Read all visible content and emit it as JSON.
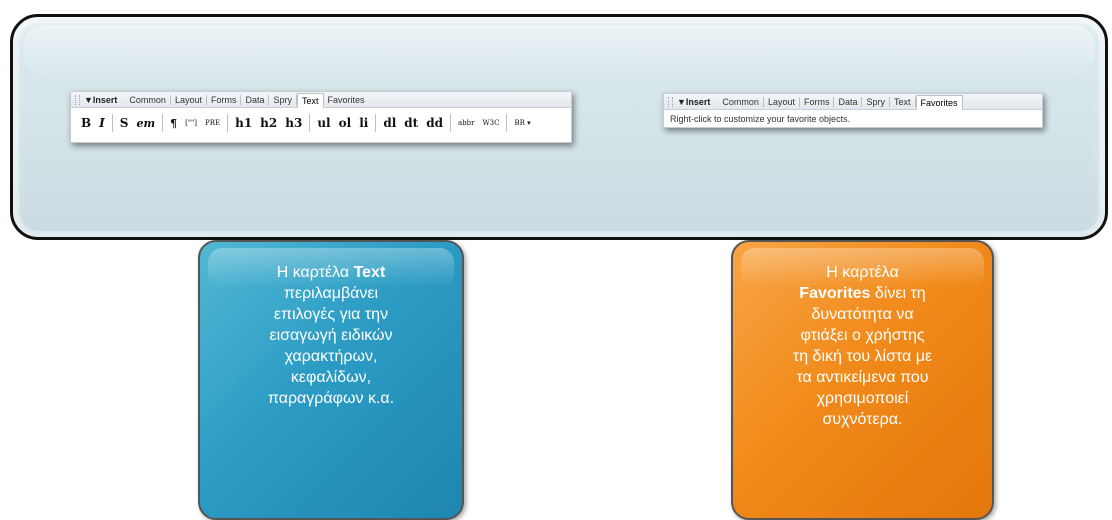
{
  "left_toolbar": {
    "insert_label": "▼Insert",
    "tabs": [
      "Common",
      "Layout",
      "Forms",
      "Data",
      "Spry",
      "Text",
      "Favorites"
    ],
    "active_tab": "Text",
    "buttons": [
      "B",
      "I",
      "S",
      "em",
      "¶",
      "[\"\"]",
      "PRE",
      "h1",
      "h2",
      "h3",
      "ul",
      "ol",
      "li",
      "dl",
      "dt",
      "dd",
      "abbr",
      "W3C",
      "BR"
    ]
  },
  "right_toolbar": {
    "insert_label": "▼Insert",
    "tabs": [
      "Common",
      "Layout",
      "Forms",
      "Data",
      "Spry",
      "Text",
      "Favorites"
    ],
    "active_tab": "Favorites",
    "hint": "Right-click to customize your favorite objects."
  },
  "callouts": {
    "text": {
      "prefix": "Η καρτέλα ",
      "strong": "Text",
      "body": "περιλαμβάνει επιλογές για την εισαγωγή ειδικών χαρακτήρων, κεφαλίδων, παραγράφων κ.α."
    },
    "favorites": {
      "prefix": "Η καρτέλα ",
      "strong": "Favorites",
      "body": "δίνει τη δυνατότητα να φτιάξει ο χρήστης τη δική του λίστα με τα αντικείμενα που χρησιμοποιεί συχνότερα."
    }
  },
  "colors": {
    "text_callout": "#2c9cc4",
    "favorites_callout": "#f18a1a",
    "panel": "#d3e3e8"
  }
}
